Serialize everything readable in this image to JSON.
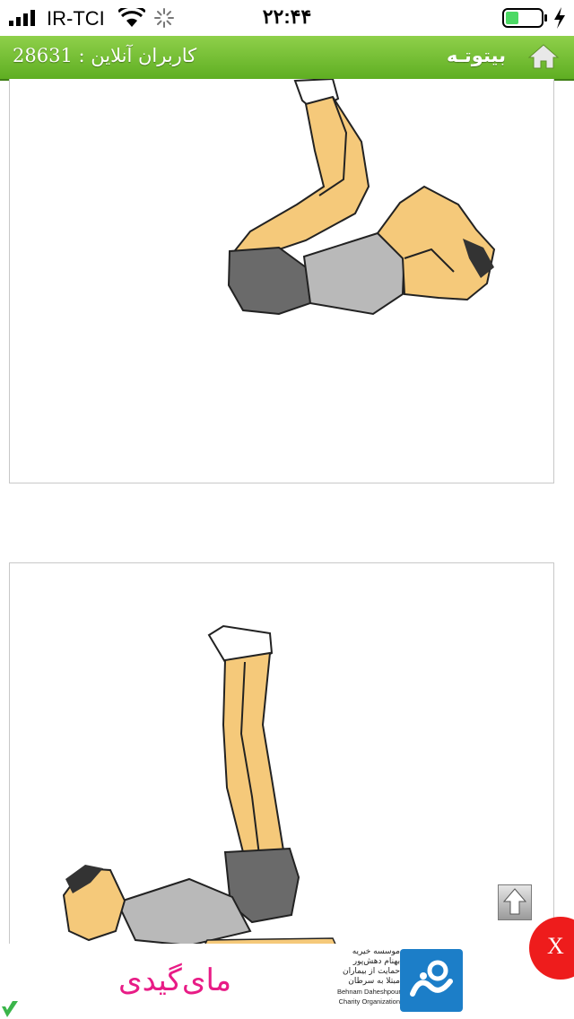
{
  "status_bar": {
    "carrier": "IR-TCI",
    "time": "۲۲:۴۴",
    "battery_color": "#4cd964"
  },
  "header": {
    "brand": "بیتوتـه",
    "online_users": "کاربران آنلاین : 28631",
    "color": "#6cbc2c"
  },
  "content": {
    "images": [
      {
        "icon": "crunch-exercise-illustration"
      },
      {
        "icon": "leg-raise-exercise-illustration"
      }
    ]
  },
  "ad": {
    "brand_name": "مای‌گیدی",
    "org_lines": [
      "موسسه خیریه",
      "بهنام دهش‌پور",
      "حمایت از بیماران",
      "مبتلا به سرطان"
    ],
    "org_en_lines": [
      "Behnam Daheshpour",
      "Charity Organization"
    ],
    "close_label": "X",
    "accent_color": "#e81c86"
  }
}
